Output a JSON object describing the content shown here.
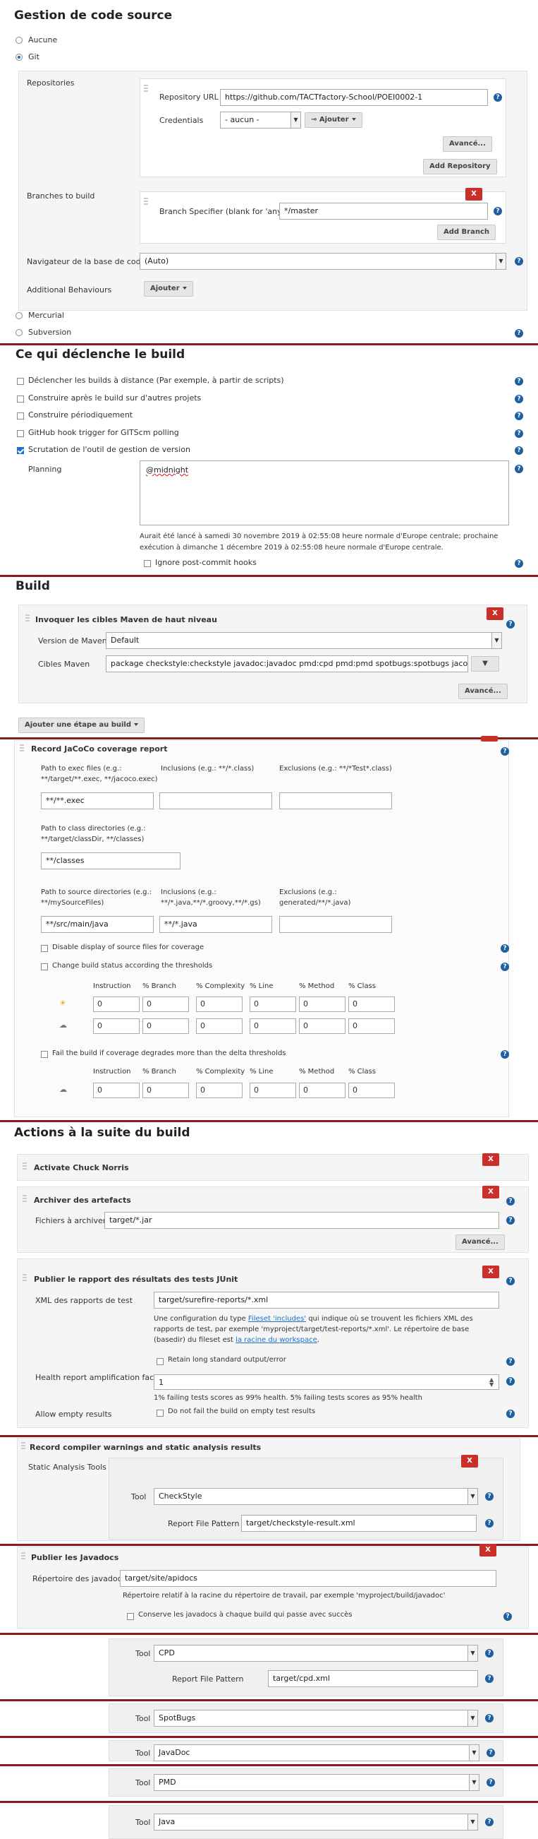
{
  "scm": {
    "title": "Gestion de code source",
    "none": "Aucune",
    "git": "Git",
    "repositories_label": "Repositories",
    "repo_url_label": "Repository URL",
    "repo_url": "https://github.com/TACTfactory-School/POEI0002-1",
    "credentials_label": "Credentials",
    "credentials_value": "- aucun -",
    "add_cred": "Ajouter",
    "advanced": "Avancé...",
    "add_repo": "Add Repository",
    "branches_label": "Branches to build",
    "branch_spec_label": "Branch Specifier (blank for 'any')",
    "branch_spec": "*/master",
    "add_branch": "Add Branch",
    "x": "X",
    "browser_label": "Navigateur de la base de code",
    "browser_value": "(Auto)",
    "additional_label": "Additional Behaviours",
    "additional_btn": "Ajouter",
    "mercurial": "Mercurial",
    "subversion": "Subversion"
  },
  "triggers": {
    "title": "Ce qui déclenche le build",
    "items": [
      {
        "label": "Déclencher les builds à distance (Par exemple, à partir de scripts)",
        "checked": false
      },
      {
        "label": "Construire après le build sur d'autres projets",
        "checked": false
      },
      {
        "label": "Construire périodiquement",
        "checked": false
      },
      {
        "label": "GitHub hook trigger for GITScm polling",
        "checked": false
      },
      {
        "label": "Scrutation de l'outil de gestion de version",
        "checked": true
      }
    ],
    "planning_label": "Planning",
    "planning_value": "@midnight",
    "planning_note": "Aurait été lancé à samedi 30 novembre 2019 à 02:55:08 heure normale d'Europe centrale; prochaine exécution à dimanche 1 décembre 2019 à 02:55:08 heure normale d'Europe centrale.",
    "ignore_hooks": "Ignore post-commit hooks"
  },
  "build": {
    "title": "Build",
    "step_title": "Invoquer les cibles Maven de haut niveau",
    "maven_version_label": "Version de Maven",
    "maven_version": "Default",
    "targets_label": "Cibles Maven",
    "targets": "package checkstyle:checkstyle javadoc:javadoc pmd:cpd pmd:pmd spotbugs:spotbugs jacoco:report",
    "advanced": "Avancé...",
    "add_step": "Ajouter une étape au build",
    "x": "X"
  },
  "jacoco": {
    "title": "Record JaCoCo coverage report",
    "exec_label": "Path to exec files (e.g.: **/target/**.exec, **/jacoco.exec)",
    "incl_label": "Inclusions (e.g.: **/*.class)",
    "excl_label": "Exclusions (e.g.: **/*Test*.class)",
    "exec_value": "**/**.exec",
    "class_label": "Path to class directories (e.g.: **/target/classDir, **/classes)",
    "class_value": "**/classes",
    "src_label": "Path to source directories (e.g.: **/mySourceFiles)",
    "src_incl_label": "Inclusions (e.g.: **/*.java,**/*.groovy,**/*.gs)",
    "src_excl_label": "Exclusions (e.g.: generated/**/*.java)",
    "src_value": "**/src/main/java",
    "src_incl_value": "**/*.java",
    "disable_display": "Disable display of source files for coverage",
    "change_status": "Change build status according the thresholds",
    "columns": [
      "Instruction",
      "% Branch",
      "% Complexity",
      "% Line",
      "% Method",
      "% Class"
    ],
    "row_values": [
      "0",
      "0",
      "0",
      "0",
      "0",
      "0"
    ],
    "fail_label": "Fail the build if coverage degrades more than the delta thresholds"
  },
  "post": {
    "title": "Actions à la suite du build",
    "chuck": "Activate Chuck Norris",
    "archive_title": "Archiver des artefacts",
    "archive_label": "Fichiers à archiver",
    "archive_value": "target/*.jar",
    "advanced": "Avancé...",
    "junit_title": "Publier le rapport des résultats des tests JUnit",
    "junit_label": "XML des rapports de test",
    "junit_value": "target/surefire-reports/*.xml",
    "junit_note_a": "Une configuration du type ",
    "junit_note_link": "Fileset 'includes'",
    "junit_note_b": " qui indique où se trouvent les fichiers XML des rapports de test, par exemple 'myproject/target/test-reports/*.xml'. Le répertoire de base (basedir) du fileset est ",
    "junit_note_link2": "la racine du workspace",
    "junit_note_c": ".",
    "retain": "Retain long standard output/error",
    "health_label": "Health report amplification factor",
    "health_value": "1",
    "health_note": "1% failing tests scores as 99% health. 5% failing tests scores as 95% health",
    "allow_empty_label": "Allow empty results",
    "allow_empty_cb": "Do not fail the build on empty test results",
    "x": "X"
  },
  "warnings": {
    "title": "Record compiler warnings and static analysis results",
    "tools_label": "Static Analysis Tools",
    "tool_label": "Tool",
    "tool_value": "CheckStyle",
    "pattern_label": "Report File Pattern",
    "pattern_value": "target/checkstyle-result.xml",
    "x": "X"
  },
  "javadoc": {
    "title": "Publier les Javadocs",
    "dir_label": "Répertoire des javadocs",
    "dir_value": "target/site/apidocs",
    "dir_note": "Répertoire relatif à la racine du répertoire de travail, par exemple 'myproject/build/javadoc'",
    "keep_all": "Conserve les javadocs à chaque build qui passe avec succès",
    "x": "X"
  },
  "tools": [
    {
      "label": "Tool",
      "value": "CPD",
      "pattern_label": "Report File Pattern",
      "pattern_value": "target/cpd.xml"
    },
    {
      "label": "Tool",
      "value": "SpotBugs"
    },
    {
      "label": "Tool",
      "value": "JavaDoc"
    },
    {
      "label": "Tool",
      "value": "PMD"
    },
    {
      "label": "Tool",
      "value": "Java"
    }
  ],
  "colors": {
    "accent": "#1f6fcc",
    "danger": "#c9302c",
    "divider": "#8b1a1a"
  }
}
